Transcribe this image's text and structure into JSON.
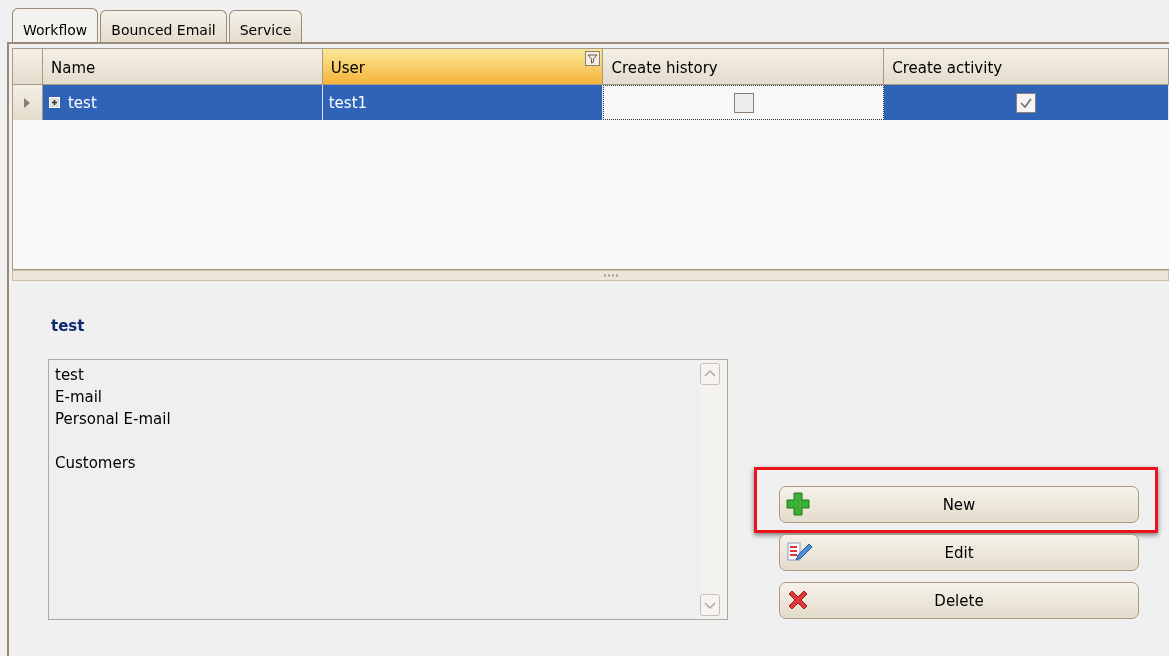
{
  "tabs": [
    {
      "label": "Workflow",
      "selected": true
    },
    {
      "label": "Bounced Email",
      "selected": false
    },
    {
      "label": "Service",
      "selected": false
    }
  ],
  "grid": {
    "columns": [
      {
        "label": "Name",
        "highlighted": false
      },
      {
        "label": "User",
        "highlighted": true
      },
      {
        "label": "Create history",
        "highlighted": false
      },
      {
        "label": "Create activity",
        "highlighted": false
      }
    ],
    "rows": [
      {
        "selected": true,
        "cells": [
          {
            "kind": "tree",
            "value": "test"
          },
          {
            "kind": "text",
            "value": "test1"
          },
          {
            "kind": "checkbox",
            "checked": false,
            "focused": true
          },
          {
            "kind": "checkbox",
            "checked": true,
            "focused": false
          }
        ]
      }
    ]
  },
  "detail": {
    "title": "test",
    "lines": [
      {
        "text": "test",
        "blank_before": false
      },
      {
        "text": "E-mail",
        "blank_before": false
      },
      {
        "text": "Personal E-mail",
        "blank_before": false
      },
      {
        "text": "Customers",
        "blank_before": true
      }
    ]
  },
  "buttons": [
    {
      "kind": "new",
      "label": "New",
      "highlighted": true
    },
    {
      "kind": "edit",
      "label": "Edit",
      "highlighted": false
    },
    {
      "kind": "delete",
      "label": "Delete",
      "highlighted": false
    }
  ]
}
